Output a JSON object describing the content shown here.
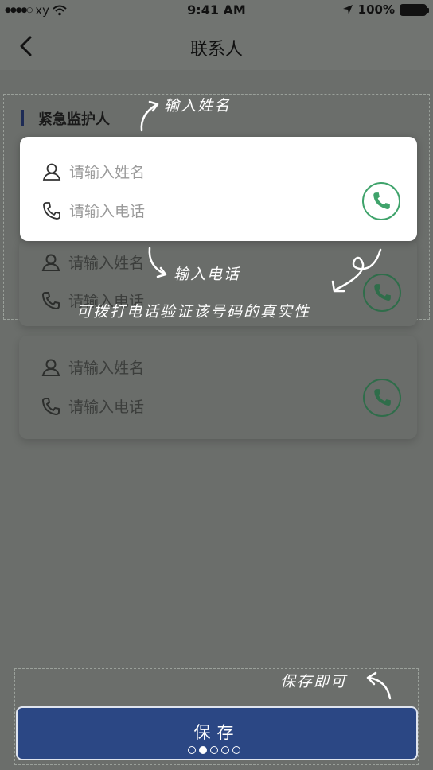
{
  "status_bar": {
    "carrier": "xy",
    "time": "9:41 AM",
    "battery": "100%"
  },
  "nav": {
    "title": "联系人",
    "back_icon": "chevron-left-icon"
  },
  "section": {
    "title": "紧急监护人"
  },
  "contacts": [
    {
      "name_placeholder": "请输入姓名",
      "phone_placeholder": "请输入电话"
    },
    {
      "name_placeholder": "请输入姓名",
      "phone_placeholder": "请输入电话"
    },
    {
      "name_placeholder": "请输入姓名",
      "phone_placeholder": "请输入电话"
    }
  ],
  "annotations": {
    "enter_name": "输入姓名",
    "enter_phone": "输入电话",
    "call_verify": "可拨打电话验证该号码的真实性",
    "save_hint": "保存即可"
  },
  "save_button": {
    "label": "保存"
  },
  "pager": {
    "count": 5,
    "active_index": 1
  },
  "colors": {
    "primary": "#2b4784",
    "call_green": "#3fa36b",
    "overlay": "#6b6e6b"
  }
}
